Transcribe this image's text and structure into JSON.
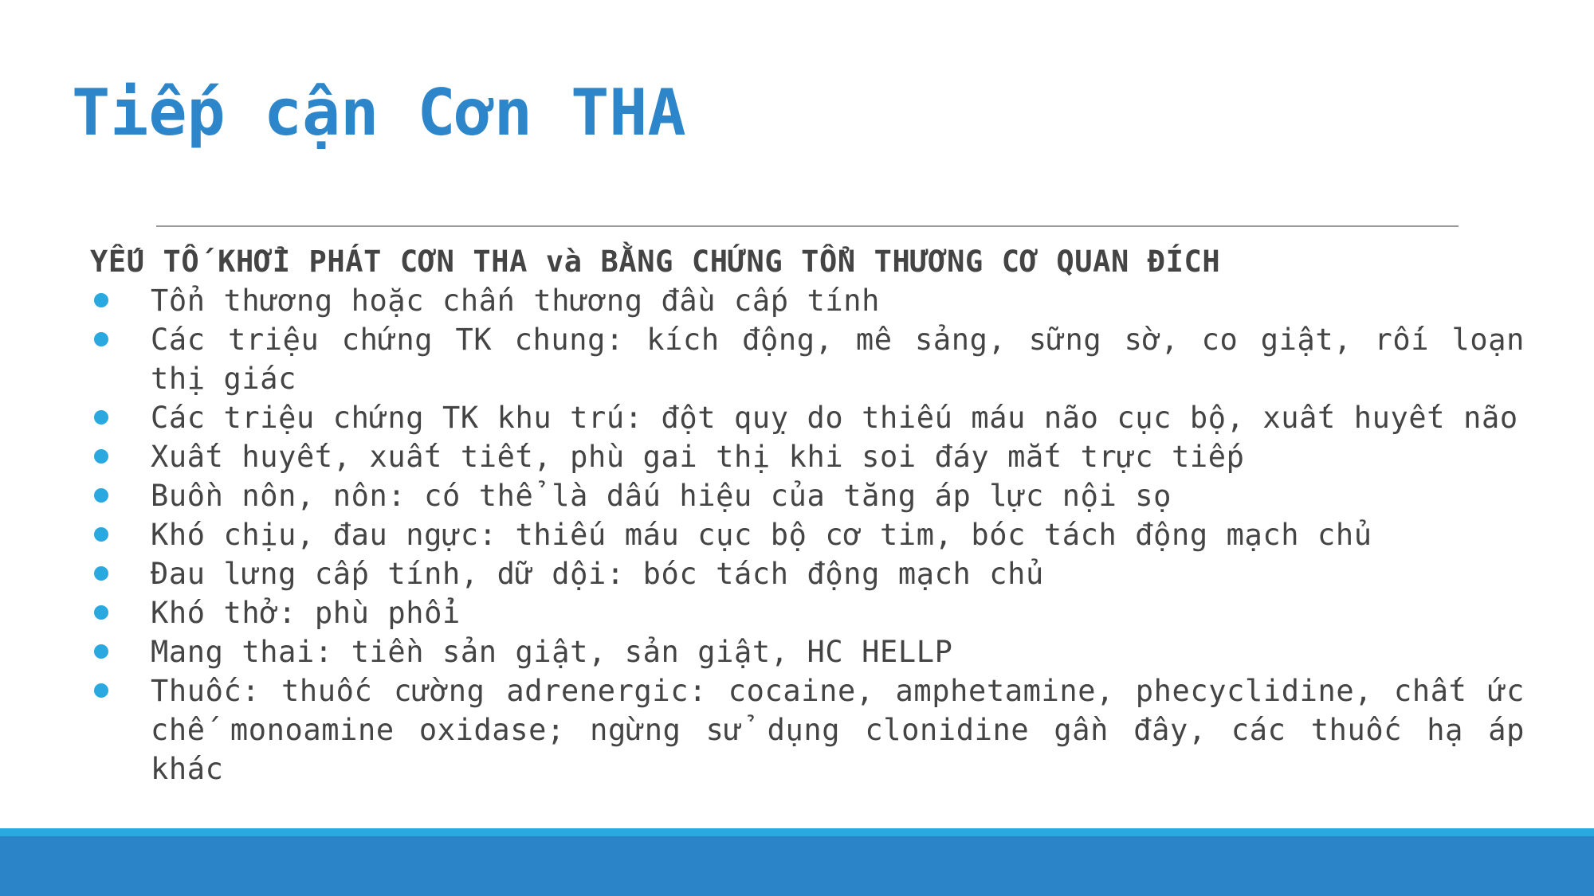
{
  "slide": {
    "title": "Tiếp cận Cơn THA",
    "heading": "YẾU TỐ KHỞI PHÁT CƠN THA và BẰNG CHỨNG TỔN THƯƠNG CƠ QUAN ĐÍCH",
    "bullets": [
      "Tổn thương hoặc chấn thương đầu cấp tính",
      "Các triệu chứng TK chung: kích động, mê sảng, sững sờ, co giật, rối loạn thị giác",
      "Các triệu chứng TK khu trú: đột quỵ do thiếu máu não cục bộ, xuất huyết não",
      "Xuất huyết, xuất tiết, phù gai thị khi soi đáy mắt trực tiếp",
      "Buồn nôn, nôn: có thể là dấu hiệu của tăng áp lực nội sọ",
      "Khó chịu, đau ngực: thiếu máu cục bộ cơ tim, bóc tách động mạch chủ",
      "Đau lưng cấp tính, dữ dội: bóc tách động mạch chủ",
      "Khó thở: phù phổi",
      "Mang thai: tiền sản giật, sản giật, HC HELLP",
      "Thuốc: thuốc cường adrenergic: cocaine, amphetamine, phecyclidine, chất ức chế monoamine oxidase; ngừng sử dụng clonidine gần đây, các thuốc hạ áp khác"
    ]
  },
  "colors": {
    "title": "#2d86c9",
    "body_text": "#444444",
    "bullet": "#2aa8e0",
    "divider": "#9a9a9a",
    "footer_band": "#2a84c7",
    "footer_stripe": "#2aa8e0"
  }
}
